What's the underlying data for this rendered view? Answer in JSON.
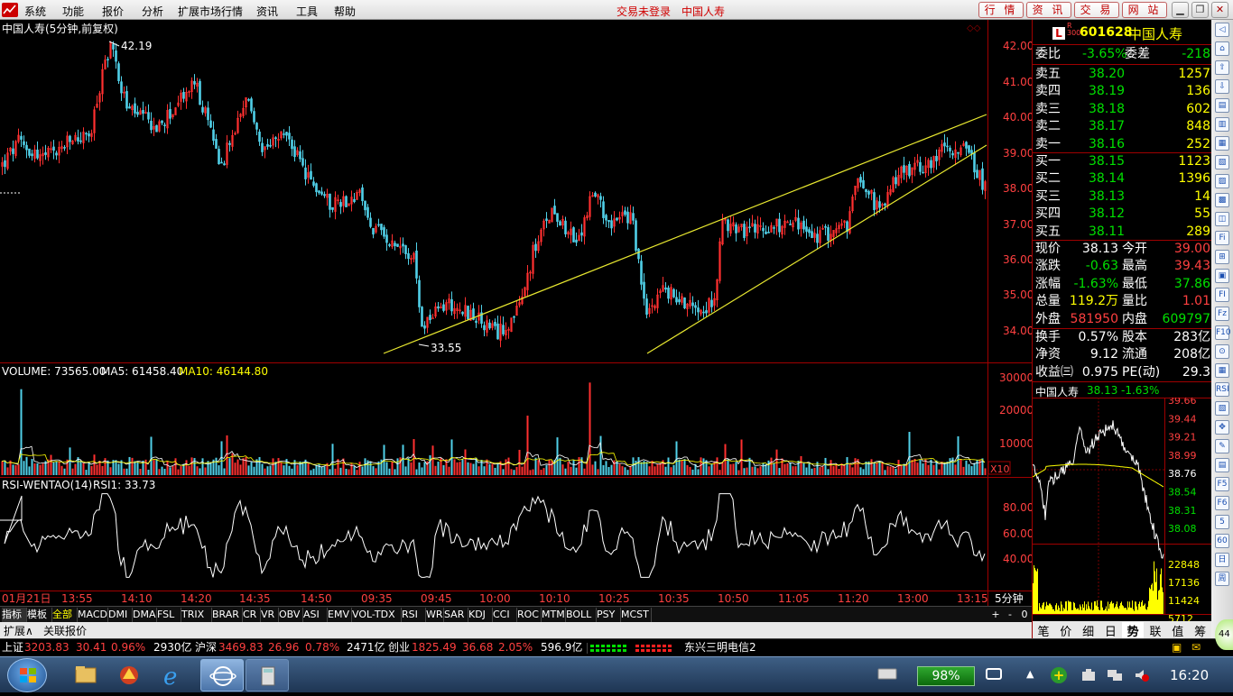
{
  "menubar": {
    "items": [
      "系统",
      "功能",
      "报价",
      "分析",
      "扩展市场行情",
      "资讯",
      "工具",
      "帮助"
    ],
    "login_status": "交易未登录",
    "stock_name": "中国人寿",
    "tab_buttons": [
      "行 情",
      "资 讯",
      "交 易",
      "网 站"
    ]
  },
  "kline": {
    "title": "中国人寿(5分钟,前复权)",
    "high_label": "42.19",
    "low_label": "33.55",
    "price_axis": [
      "42.00",
      "41.00",
      "40.00",
      "39.00",
      "38.00",
      "37.00",
      "36.00",
      "35.00",
      "34.00"
    ]
  },
  "volume": {
    "label_volume": "VOLUME: 73565.00",
    "label_ma5": "MA5: 61458.40",
    "label_ma10": "MA10: 46144.80",
    "axis": [
      "30000",
      "20000",
      "10000"
    ],
    "unit": "X10"
  },
  "rsi": {
    "label": "RSI-WENTAO(14)",
    "label_value": "RSI1: 33.73",
    "axis": [
      "80.00",
      "60.00",
      "40.00"
    ]
  },
  "time_axis": [
    "01月21日",
    "13:55",
    "14:10",
    "14:20",
    "14:35",
    "14:50",
    "09:35",
    "09:45",
    "10:00",
    "10:10",
    "10:25",
    "10:35",
    "10:50",
    "11:05",
    "11:20",
    "13:00",
    "13:15"
  ],
  "period_label": "5分钟",
  "indicator_tabs": [
    "指标",
    "模板",
    "全部",
    "MACD",
    "DMI",
    "DMA",
    "FSL",
    "TRIX",
    "BRAR",
    "CR",
    "VR",
    "OBV",
    "ASI",
    "EMV",
    "VOL-TDX",
    "RSI",
    "WR",
    "SAR",
    "KDJ",
    "CCI",
    "ROC",
    "MTM",
    "BOLL",
    "PSY",
    "MCST"
  ],
  "tab_controls": [
    "+",
    "-",
    "0"
  ],
  "ext_tabs": [
    "扩展∧",
    "关联报价"
  ],
  "quote": {
    "badge_letter": "L",
    "badge_sub": "R\n300",
    "code": "601628",
    "name": "中国人寿",
    "weibi_label": "委比",
    "weibi": "-3.65%",
    "weicha_label": "委差",
    "weicha": "-218",
    "asks": [
      {
        "label": "卖五",
        "price": "38.20",
        "vol": "1257"
      },
      {
        "label": "卖四",
        "price": "38.19",
        "vol": "136"
      },
      {
        "label": "卖三",
        "price": "38.18",
        "vol": "602"
      },
      {
        "label": "卖二",
        "price": "38.17",
        "vol": "848"
      },
      {
        "label": "卖一",
        "price": "38.16",
        "vol": "252"
      }
    ],
    "bids": [
      {
        "label": "买一",
        "price": "38.15",
        "vol": "1123"
      },
      {
        "label": "买二",
        "price": "38.14",
        "vol": "1396"
      },
      {
        "label": "买三",
        "price": "38.13",
        "vol": "14"
      },
      {
        "label": "买四",
        "price": "38.12",
        "vol": "55"
      },
      {
        "label": "买五",
        "price": "38.11",
        "vol": "289"
      }
    ],
    "stats": [
      {
        "l1": "现价",
        "v1": "38.13",
        "l2": "今开",
        "v2": "39.00",
        "c1": "#ffffff",
        "c2": "#ff4040"
      },
      {
        "l1": "涨跌",
        "v1": "-0.63",
        "l2": "最高",
        "v2": "39.43",
        "c1": "#00e000",
        "c2": "#ff4040"
      },
      {
        "l1": "涨幅",
        "v1": "-1.63%",
        "l2": "最低",
        "v2": "37.86",
        "c1": "#00e000",
        "c2": "#00e000"
      },
      {
        "l1": "总量",
        "v1": "119.2万",
        "l2": "量比",
        "v2": "1.01",
        "c1": "#ffff00",
        "c2": "#ff4040"
      },
      {
        "l1": "外盘",
        "v1": "581950",
        "l2": "内盘",
        "v2": "609797",
        "c1": "#ff4040",
        "c2": "#00e000"
      },
      {
        "l1": "换手",
        "v1": "0.57%",
        "l2": "股本",
        "v2": "283亿",
        "c1": "#ffffff",
        "c2": "#ffffff"
      },
      {
        "l1": "净资",
        "v1": "9.12",
        "l2": "流通",
        "v2": "208亿",
        "c1": "#ffffff",
        "c2": "#ffffff"
      },
      {
        "l1": "收益㈢",
        "v1": "0.975",
        "l2": "PE(动)",
        "v2": "29.3",
        "c1": "#ffffff",
        "c2": "#ffffff"
      }
    ]
  },
  "mini": {
    "name": "中国人寿",
    "price": "38.13",
    "change": "-1.63%",
    "price_axis": [
      {
        "v": "39.66",
        "c": "#ff4040"
      },
      {
        "v": "39.44",
        "c": "#ff4040"
      },
      {
        "v": "39.21",
        "c": "#ff4040"
      },
      {
        "v": "38.99",
        "c": "#ff4040"
      },
      {
        "v": "38.76",
        "c": "#ffffff"
      },
      {
        "v": "38.54",
        "c": "#00e000"
      },
      {
        "v": "38.31",
        "c": "#00e000"
      },
      {
        "v": "38.08",
        "c": "#00e000"
      }
    ],
    "vol_axis": [
      "22848",
      "17136",
      "11424",
      "5712"
    ],
    "tabs": [
      "笔",
      "价",
      "细",
      "日",
      "势",
      "联",
      "值",
      "筹"
    ]
  },
  "statusbar": {
    "sh_label": "上证",
    "sh_value": "3203.83",
    "sh_change": "30.41",
    "sh_pct": "0.96%",
    "sh_amount": "2930亿",
    "hs_label": "沪深",
    "hs_value": "3469.83",
    "hs_change": "26.96",
    "hs_pct": "0.78%",
    "hs_amount": "2471亿",
    "cy_label": "创业",
    "cy_value": "1825.49",
    "cy_change": "36.68",
    "cy_pct": "2.05%",
    "cy_amount": "596.9亿",
    "server": "东兴三明电信2"
  },
  "taskbar": {
    "battery": "98%",
    "clock": "16:20"
  },
  "right_toolbar": [
    "◁",
    "⌂",
    "⇧",
    "⇩",
    "▤",
    "▥",
    "▦",
    "▧",
    "▨",
    "▩",
    "◫",
    "Fi",
    "⊞",
    "▣",
    "FI",
    "Fz",
    "F10",
    "⊙",
    "▦",
    "RSI",
    "▧",
    "✥",
    "✎",
    "▤",
    "F5",
    "F6",
    "5",
    "60",
    "日",
    "周"
  ]
}
